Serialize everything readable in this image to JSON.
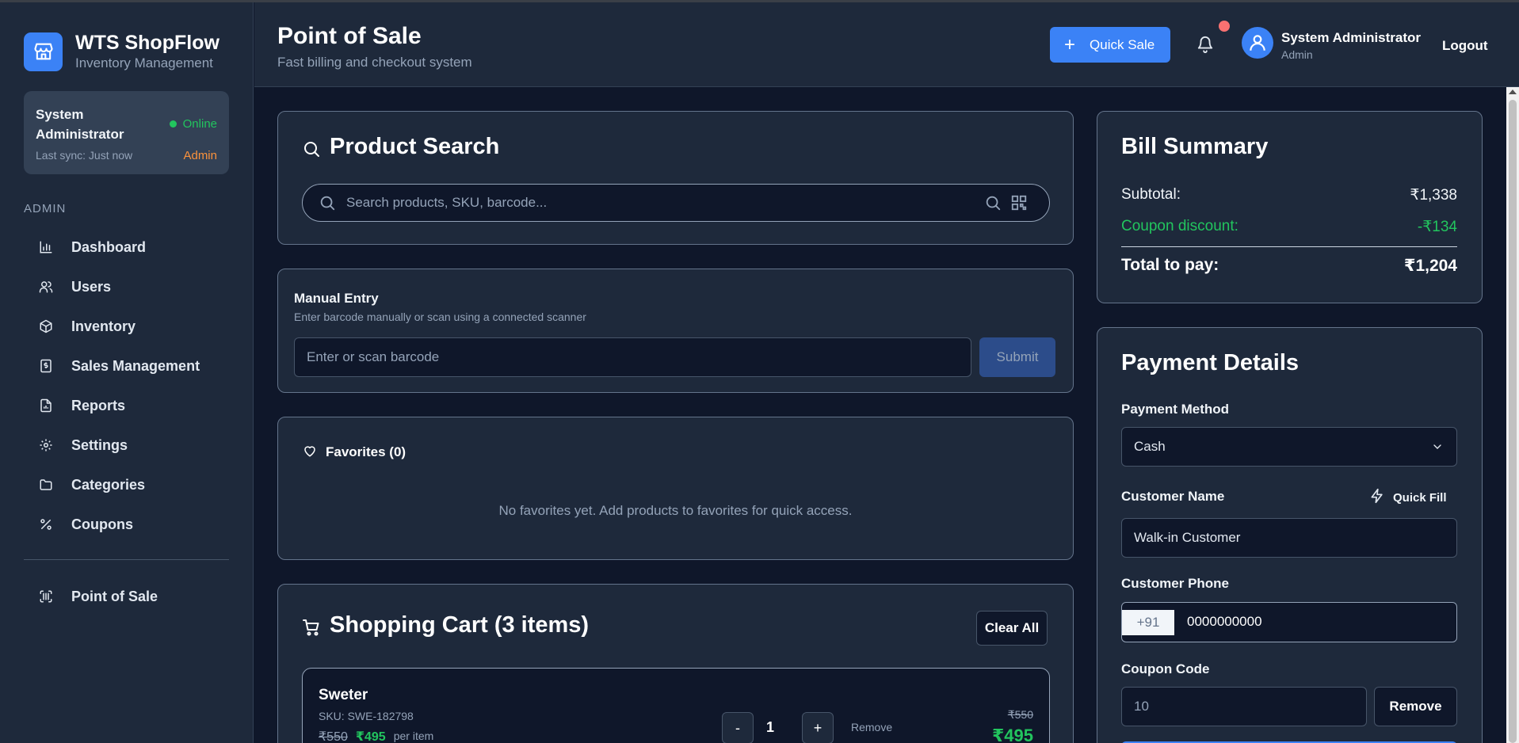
{
  "brand": {
    "name": "WTS ShopFlow",
    "subtitle": "Inventory Management"
  },
  "user_card": {
    "name": "System Administrator",
    "status": "Online",
    "last_sync": "Last sync: Just now",
    "role": "Admin"
  },
  "nav": {
    "heading": "ADMIN",
    "items": [
      {
        "label": "Dashboard",
        "icon": "bar-chart-icon"
      },
      {
        "label": "Users",
        "icon": "users-icon"
      },
      {
        "label": "Inventory",
        "icon": "package-icon"
      },
      {
        "label": "Sales Management",
        "icon": "receipt-icon"
      },
      {
        "label": "Reports",
        "icon": "report-icon"
      },
      {
        "label": "Settings",
        "icon": "gear-icon"
      },
      {
        "label": "Categories",
        "icon": "folder-icon"
      },
      {
        "label": "Coupons",
        "icon": "percent-icon"
      }
    ],
    "pos": {
      "label": "Point of Sale",
      "icon": "barcode-scan-icon"
    }
  },
  "header": {
    "title": "Point of Sale",
    "subtitle": "Fast billing and checkout system",
    "quick_sale": "Quick Sale",
    "user_name": "System Administrator",
    "user_role": "Admin",
    "logout": "Logout"
  },
  "product_search": {
    "title": "Product Search",
    "placeholder": "Search products, SKU, barcode..."
  },
  "manual_entry": {
    "title": "Manual Entry",
    "hint": "Enter barcode manually or scan using a connected scanner",
    "placeholder": "Enter or scan barcode",
    "submit": "Submit"
  },
  "favorites": {
    "title": "Favorites (0)",
    "empty": "No favorites yet. Add products to favorites for quick access."
  },
  "cart": {
    "title": "Shopping Cart (3 items)",
    "clear_all": "Clear All",
    "items": [
      {
        "name": "Sweter",
        "sku": "SKU: SWE-182798",
        "orig_price": "₹550",
        "price": "₹495",
        "per_item": "per item",
        "qty": "1",
        "minus": "-",
        "plus": "+",
        "remove": "Remove",
        "line_orig": "₹550",
        "line_total": "₹495"
      }
    ]
  },
  "bill": {
    "title": "Bill Summary",
    "subtotal_label": "Subtotal:",
    "subtotal": "₹1,338",
    "coupon_label": "Coupon discount:",
    "coupon": "-₹134",
    "total_label": "Total to pay:",
    "total": "₹1,204"
  },
  "payment": {
    "title": "Payment Details",
    "method_label": "Payment Method",
    "method_value": "Cash",
    "customer_label": "Customer Name",
    "quick_fill": "Quick Fill",
    "customer_value": "Walk-in Customer",
    "phone_label": "Customer Phone",
    "phone_prefix": "+91",
    "phone_value": "0000000000",
    "coupon_label": "Coupon Code",
    "coupon_placeholder": "10",
    "coupon_remove": "Remove"
  },
  "colors": {
    "accent": "#3b82f6",
    "success": "#22c55e",
    "warning": "#fb923c",
    "danger": "#f87171"
  }
}
